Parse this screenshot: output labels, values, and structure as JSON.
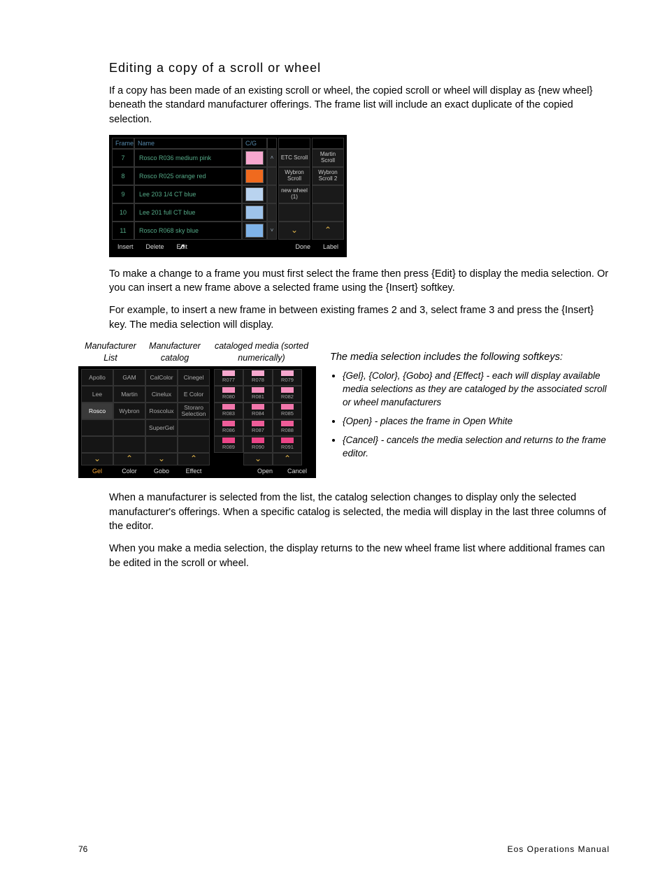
{
  "heading": "Editing a copy of a scroll or wheel",
  "para1": "If a copy has been made of an existing scroll or wheel, the copied scroll or wheel will display as {new wheel} beneath the standard manufacturer offerings. The frame list will include an exact duplicate of the copied selection.",
  "para2": "To make a change to a frame you must first select the frame then press {Edit} to display the media selection. Or you can insert a new frame above a selected frame using the {Insert} softkey.",
  "para3": "For example, to insert a new frame in between existing frames 2 and 3, select frame 3 and press the {Insert} key. The media selection will display.",
  "para4": "When a manufacturer is selected from the list, the catalog selection changes to display only the selected manufacturer's offerings. When a specific catalog is selected, the media will display in the last three columns of the editor.",
  "para5": "When you make a media selection, the display returns to the new wheel frame list where additional frames can be edited in the scroll or wheel.",
  "fig1": {
    "headers": {
      "frame": "Frame",
      "name": "Name",
      "cg": "C/G"
    },
    "rows": [
      {
        "n": "7",
        "name": "Rosco R036 medium pink",
        "color": "#f7a8cf"
      },
      {
        "n": "8",
        "name": "Rosco R025 orange red",
        "color": "#f06a1e"
      },
      {
        "n": "9",
        "name": "Lee 203 1/4 CT blue",
        "color": "#b9d3ef"
      },
      {
        "n": "10",
        "name": "Lee 201 full CT blue",
        "color": "#9ec3ea"
      },
      {
        "n": "11",
        "name": "Rosco R068 sky blue",
        "color": "#7fb3e8"
      }
    ],
    "side": [
      [
        "ETC Scroll",
        "Martin Scroll"
      ],
      [
        "Wybron Scroll",
        "Wybron Scroll 2"
      ],
      [
        "new wheel (1)",
        ""
      ],
      [
        "",
        ""
      ],
      [
        "",
        ""
      ]
    ],
    "footer": {
      "insert": "Insert",
      "delete": "Delete",
      "edit": "Edit",
      "done": "Done",
      "label": "Label"
    }
  },
  "fig2_labels": {
    "mfr_list": "Manufacturer List",
    "mfr_catalog": "Manufacturer catalog",
    "media": "cataloged media (sorted numerically)"
  },
  "fig2": {
    "col1": [
      "Apollo",
      "Lee",
      "Rosco",
      "",
      ""
    ],
    "col2": [
      "GAM",
      "Martin",
      "Wybron",
      "",
      ""
    ],
    "col3": [
      "CalColor",
      "Cinelux",
      "Roscolux",
      "SuperGel",
      ""
    ],
    "col4": [
      "Cinegel",
      "E Color",
      "Storaro Selection",
      "",
      ""
    ],
    "media": [
      [
        "R077",
        "R078",
        "R079"
      ],
      [
        "R080",
        "R081",
        "R082"
      ],
      [
        "R083",
        "R084",
        "R085"
      ],
      [
        "R086",
        "R087",
        "R088"
      ],
      [
        "R089",
        "R090",
        "R091"
      ]
    ],
    "footer": {
      "gel": "Gel",
      "color": "Color",
      "gobo": "Gobo",
      "effect": "Effect",
      "open": "Open",
      "cancel": "Cancel"
    },
    "selected_mfr": "Rosco"
  },
  "right": {
    "intro": "The media selection includes the following softkeys:",
    "items": [
      "{Gel}, {Color}, {Gobo} and {Effect} - each will display available media selections as they are cataloged by the associated scroll or wheel manufacturers",
      "{Open} - places the frame in Open White",
      "{Cancel} - cancels the media selection and returns to the frame editor."
    ]
  },
  "footer": {
    "page": "76",
    "manual": "Eos Operations Manual"
  }
}
